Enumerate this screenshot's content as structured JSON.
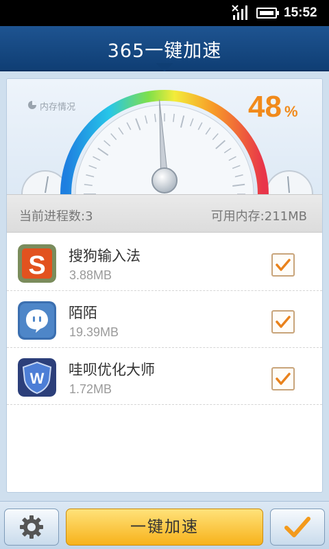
{
  "status_bar": {
    "time": "15:52"
  },
  "header": {
    "title": "365一键加速"
  },
  "gauge": {
    "label": "内存情况",
    "percent": "48",
    "percent_sign": "%",
    "needle_value": 0.48
  },
  "info": {
    "process_count": "当前进程数:3",
    "free_memory": "可用内存:211MB"
  },
  "apps": [
    {
      "name": "搜狗输入法",
      "size": "3.88MB",
      "checked": true,
      "icon": "sogou-input-icon"
    },
    {
      "name": "陌陌",
      "size": "19.39MB",
      "checked": true,
      "icon": "momo-icon"
    },
    {
      "name": "哇呗优化大师",
      "size": "1.72MB",
      "checked": true,
      "icon": "wabei-optimizer-icon"
    }
  ],
  "bottom": {
    "accelerate_label": "一键加速"
  },
  "colors": {
    "accent": "#f18a1b",
    "header": "#1e5491",
    "button": "#f7b21b"
  }
}
